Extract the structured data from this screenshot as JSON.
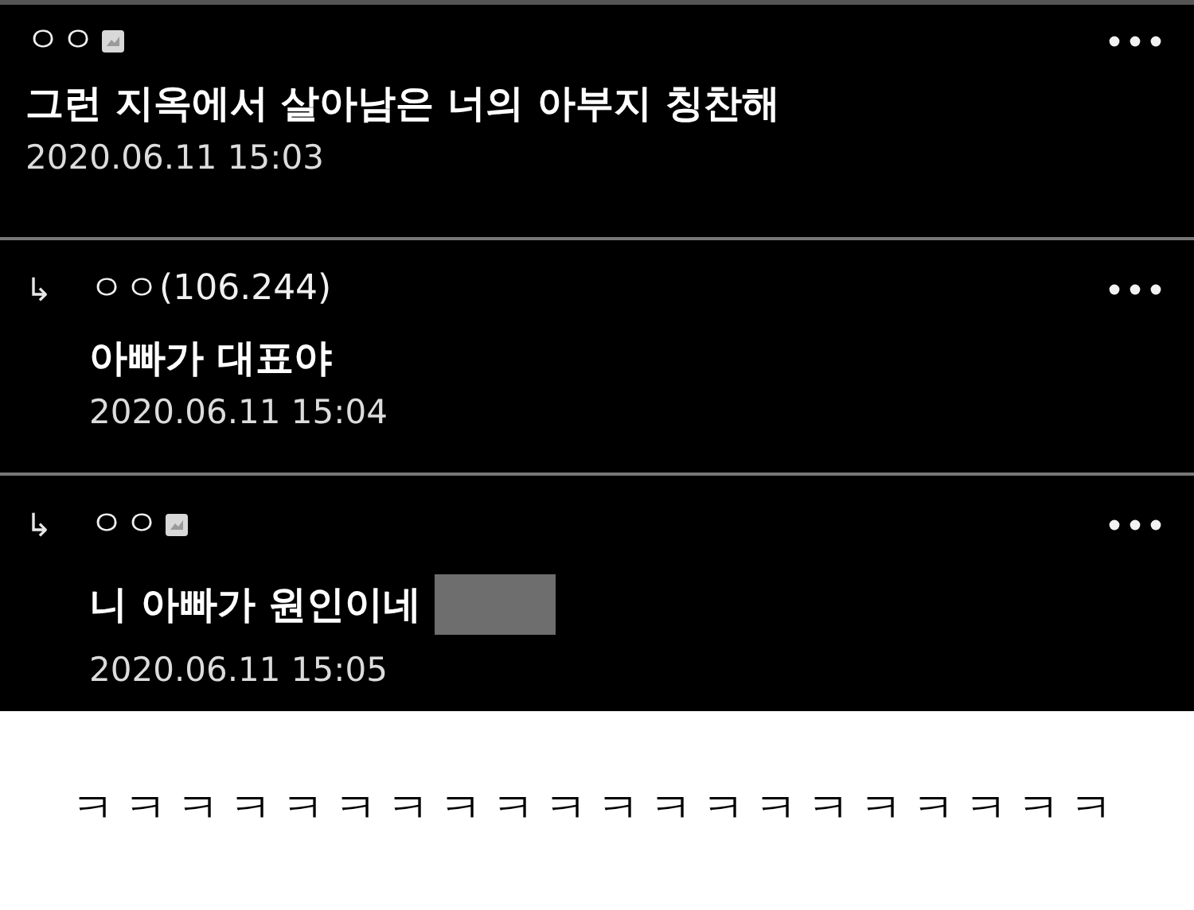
{
  "comments": [
    {
      "kind": "comment",
      "author": "ㅇㅇ",
      "badge": true,
      "text": "그런 지옥에서 살아남은 너의 아부지 칭찬해",
      "time": "2020.06.11 15:03"
    },
    {
      "kind": "reply",
      "reply_mark": "↳",
      "author": "ㅇㅇ(106.244)",
      "badge": false,
      "text": "아빠가 대표야",
      "time": "2020.06.11 15:04"
    },
    {
      "kind": "reply",
      "reply_mark": "↳",
      "author": "ㅇㅇ",
      "badge": true,
      "text": "니 아빠가 원인이네",
      "censored": true,
      "time": "2020.06.11 15:05"
    }
  ],
  "caption": "ㅋㅋㅋㅋㅋㅋㅋㅋㅋㅋㅋㅋㅋㅋㅋㅋㅋㅋㅋㅋ"
}
